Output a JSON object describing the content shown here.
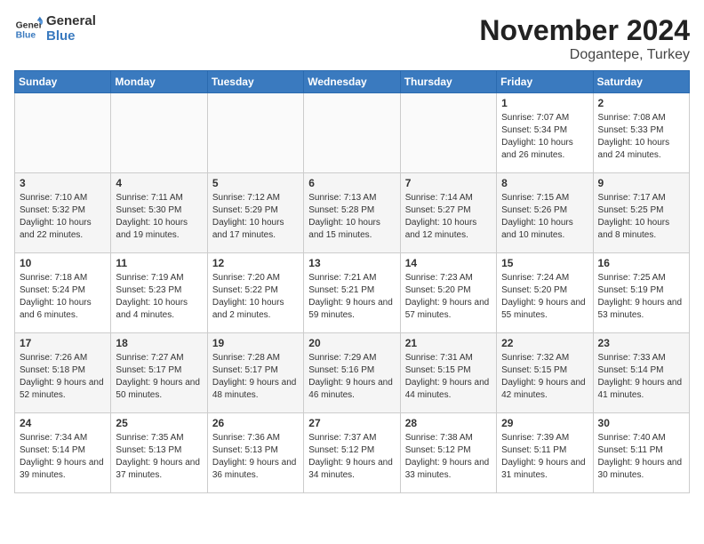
{
  "logo": {
    "line1": "General",
    "line2": "Blue"
  },
  "title": "November 2024",
  "location": "Dogantepe, Turkey",
  "days_of_week": [
    "Sunday",
    "Monday",
    "Tuesday",
    "Wednesday",
    "Thursday",
    "Friday",
    "Saturday"
  ],
  "weeks": [
    [
      {
        "day": "",
        "info": ""
      },
      {
        "day": "",
        "info": ""
      },
      {
        "day": "",
        "info": ""
      },
      {
        "day": "",
        "info": ""
      },
      {
        "day": "",
        "info": ""
      },
      {
        "day": "1",
        "info": "Sunrise: 7:07 AM\nSunset: 5:34 PM\nDaylight: 10 hours and 26 minutes."
      },
      {
        "day": "2",
        "info": "Sunrise: 7:08 AM\nSunset: 5:33 PM\nDaylight: 10 hours and 24 minutes."
      }
    ],
    [
      {
        "day": "3",
        "info": "Sunrise: 7:10 AM\nSunset: 5:32 PM\nDaylight: 10 hours and 22 minutes."
      },
      {
        "day": "4",
        "info": "Sunrise: 7:11 AM\nSunset: 5:30 PM\nDaylight: 10 hours and 19 minutes."
      },
      {
        "day": "5",
        "info": "Sunrise: 7:12 AM\nSunset: 5:29 PM\nDaylight: 10 hours and 17 minutes."
      },
      {
        "day": "6",
        "info": "Sunrise: 7:13 AM\nSunset: 5:28 PM\nDaylight: 10 hours and 15 minutes."
      },
      {
        "day": "7",
        "info": "Sunrise: 7:14 AM\nSunset: 5:27 PM\nDaylight: 10 hours and 12 minutes."
      },
      {
        "day": "8",
        "info": "Sunrise: 7:15 AM\nSunset: 5:26 PM\nDaylight: 10 hours and 10 minutes."
      },
      {
        "day": "9",
        "info": "Sunrise: 7:17 AM\nSunset: 5:25 PM\nDaylight: 10 hours and 8 minutes."
      }
    ],
    [
      {
        "day": "10",
        "info": "Sunrise: 7:18 AM\nSunset: 5:24 PM\nDaylight: 10 hours and 6 minutes."
      },
      {
        "day": "11",
        "info": "Sunrise: 7:19 AM\nSunset: 5:23 PM\nDaylight: 10 hours and 4 minutes."
      },
      {
        "day": "12",
        "info": "Sunrise: 7:20 AM\nSunset: 5:22 PM\nDaylight: 10 hours and 2 minutes."
      },
      {
        "day": "13",
        "info": "Sunrise: 7:21 AM\nSunset: 5:21 PM\nDaylight: 9 hours and 59 minutes."
      },
      {
        "day": "14",
        "info": "Sunrise: 7:23 AM\nSunset: 5:20 PM\nDaylight: 9 hours and 57 minutes."
      },
      {
        "day": "15",
        "info": "Sunrise: 7:24 AM\nSunset: 5:20 PM\nDaylight: 9 hours and 55 minutes."
      },
      {
        "day": "16",
        "info": "Sunrise: 7:25 AM\nSunset: 5:19 PM\nDaylight: 9 hours and 53 minutes."
      }
    ],
    [
      {
        "day": "17",
        "info": "Sunrise: 7:26 AM\nSunset: 5:18 PM\nDaylight: 9 hours and 52 minutes."
      },
      {
        "day": "18",
        "info": "Sunrise: 7:27 AM\nSunset: 5:17 PM\nDaylight: 9 hours and 50 minutes."
      },
      {
        "day": "19",
        "info": "Sunrise: 7:28 AM\nSunset: 5:17 PM\nDaylight: 9 hours and 48 minutes."
      },
      {
        "day": "20",
        "info": "Sunrise: 7:29 AM\nSunset: 5:16 PM\nDaylight: 9 hours and 46 minutes."
      },
      {
        "day": "21",
        "info": "Sunrise: 7:31 AM\nSunset: 5:15 PM\nDaylight: 9 hours and 44 minutes."
      },
      {
        "day": "22",
        "info": "Sunrise: 7:32 AM\nSunset: 5:15 PM\nDaylight: 9 hours and 42 minutes."
      },
      {
        "day": "23",
        "info": "Sunrise: 7:33 AM\nSunset: 5:14 PM\nDaylight: 9 hours and 41 minutes."
      }
    ],
    [
      {
        "day": "24",
        "info": "Sunrise: 7:34 AM\nSunset: 5:14 PM\nDaylight: 9 hours and 39 minutes."
      },
      {
        "day": "25",
        "info": "Sunrise: 7:35 AM\nSunset: 5:13 PM\nDaylight: 9 hours and 37 minutes."
      },
      {
        "day": "26",
        "info": "Sunrise: 7:36 AM\nSunset: 5:13 PM\nDaylight: 9 hours and 36 minutes."
      },
      {
        "day": "27",
        "info": "Sunrise: 7:37 AM\nSunset: 5:12 PM\nDaylight: 9 hours and 34 minutes."
      },
      {
        "day": "28",
        "info": "Sunrise: 7:38 AM\nSunset: 5:12 PM\nDaylight: 9 hours and 33 minutes."
      },
      {
        "day": "29",
        "info": "Sunrise: 7:39 AM\nSunset: 5:11 PM\nDaylight: 9 hours and 31 minutes."
      },
      {
        "day": "30",
        "info": "Sunrise: 7:40 AM\nSunset: 5:11 PM\nDaylight: 9 hours and 30 minutes."
      }
    ]
  ]
}
